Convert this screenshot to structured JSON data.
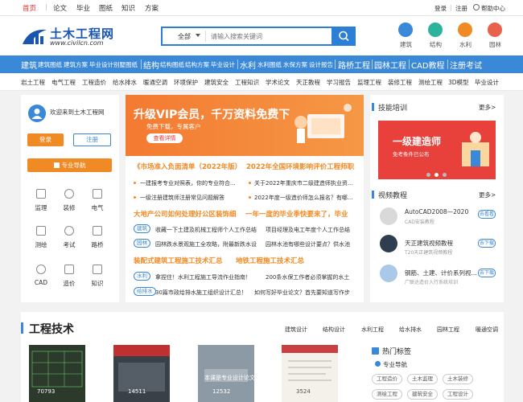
{
  "topnav": {
    "items": [
      "首页",
      "论文",
      "毕业",
      "图纸",
      "知识",
      "方案"
    ],
    "login": "登录",
    "sep": "|",
    "register": "注册",
    "help": "帮助中心"
  },
  "header": {
    "logo_cn": "土木工程网",
    "logo_url": "www.civilcn.com",
    "search_category": "全部",
    "search_placeholder": "请输入搜索关键词",
    "icons": [
      {
        "label": "建筑",
        "color": "#3a88d8"
      },
      {
        "label": "结构",
        "color": "#2cb39b"
      },
      {
        "label": "水利",
        "color": "#f08a24"
      },
      {
        "label": "园林",
        "color": "#e8624b"
      }
    ]
  },
  "bluenav": {
    "groups": [
      {
        "big": "建筑",
        "small": [
          "建筑图纸",
          "建筑方案",
          "毕业设计",
          "别墅图纸"
        ]
      },
      {
        "big": "结构",
        "small": [
          "结构图纸",
          "结构方案",
          "毕业设计"
        ]
      },
      {
        "big": "水利",
        "small": [
          "水利图纸",
          "水保方案",
          "设计报告"
        ]
      },
      {
        "big": "路桥工程"
      },
      {
        "big": "园林工程"
      },
      {
        "big": "CAD教程"
      },
      {
        "big": "注册考试"
      }
    ]
  },
  "subnav": [
    "岩土工程",
    "电气工程",
    "工程造价",
    "给水排水",
    "暖通空调",
    "环境保护",
    "建筑安全",
    "工程知识",
    "学术论文",
    "天正教程",
    "学习报告",
    "监理工程",
    "装修工程",
    "测绘工程",
    "3D模型",
    "毕业设计"
  ],
  "left": {
    "welcome": "欢迎来到土木工程网",
    "login": "登录",
    "register": "注册",
    "pro_nav": "专业导航",
    "quick": [
      {
        "label": "监理",
        "icon": "clipboard-icon"
      },
      {
        "label": "装修",
        "icon": "tools-icon"
      },
      {
        "label": "电气",
        "icon": "plug-icon"
      },
      {
        "label": "测绘",
        "icon": "map-icon"
      },
      {
        "label": "考试",
        "icon": "exam-icon"
      },
      {
        "label": "路桥",
        "icon": "bridge-icon"
      },
      {
        "label": "CAD",
        "icon": "cad-icon"
      },
      {
        "label": "造价",
        "icon": "calculator-icon"
      },
      {
        "label": "知识",
        "icon": "book-icon"
      }
    ]
  },
  "banner": {
    "title": "升级VIP会员，千万资料免费下",
    "subtitle": "免费下载，专属客户",
    "button": "查看详情"
  },
  "news": {
    "headline1a": "《市场准入负面清单（2022年版）",
    "headline1b": "2022年全国环境影响评价工程师职",
    "row1": [
      {
        "left": "一建报考专业对照表，你的专业符合...",
        "right": "关于2022年重庆市二级建造师执业资..."
      },
      {
        "left": "一级注册建筑师注册常见问题解答",
        "right": "2022年度一级造价师怎么报名？有哪..."
      }
    ],
    "headline2a": "大地产公司如何处理好公区装饰细",
    "headline2b": "一年一度的毕业季快要来了，毕业",
    "tagged": [
      {
        "tag": "建筑",
        "left": "收藏一下土建及机械工程师个人工作总结",
        "right": "项目经理及电工年度个人工作总结"
      },
      {
        "tag": "园林",
        "left": "园林跌水景观施工全攻略，附最新跌水设",
        "right": "园林水池有哪些设计要点？供水池"
      }
    ],
    "headline3a": "装配式建筑工程施工技术汇总",
    "headline3b": "地铁工程施工技术汇总",
    "tagged2": [
      {
        "tag": "水利",
        "left": "拿捏住！水利工程施工导流作业指南！",
        "right": "200条水保工作者必须掌握的水土"
      },
      {
        "tag": "给排水",
        "left": "30篇市政给排水施工组织设计汇总！",
        "right": "如何写好毕业论文？首先要知道写作步"
      }
    ]
  },
  "right": {
    "skills_title": "技能培训",
    "more": "更多>",
    "banner_title": "一级建造师",
    "banner_sub": "免考条件已公布",
    "video_title": "视频教程",
    "videos": [
      {
        "title": "AutoCAD2008—2020",
        "sub": "CAD安装教程",
        "btn": "去看看"
      },
      {
        "title": "天正建筑视频教程",
        "sub": "T20天正建筑视频教程",
        "btn": "去下载"
      },
      {
        "title": "钢筋、土建、计价系列视...",
        "sub": "广联达造价入行系统培训",
        "btn": "去下载"
      }
    ]
  },
  "bottom": {
    "title": "工程技术",
    "nav": [
      "建筑设计",
      "结构设计",
      "水利工程",
      "给水排水",
      "园林工程",
      "暖通空调"
    ],
    "thumb_counts": [
      "70793",
      "14511",
      "12532",
      "3524"
    ],
    "thumb3_caption": "本课是专业设计论文",
    "hot_title": "热门标签",
    "hot_nav": "专业导航",
    "tags": [
      "工程造价",
      "土木监理",
      "土木装修",
      "测绘工程",
      "建筑安全",
      "工程设计"
    ]
  }
}
